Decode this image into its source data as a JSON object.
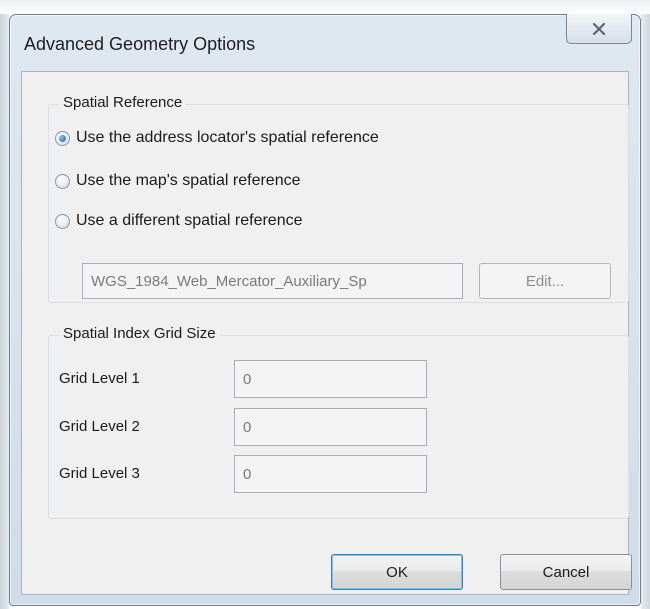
{
  "window": {
    "title": "Advanced Geometry Options",
    "close_icon": "close-x-icon"
  },
  "spatial_reference": {
    "legend": "Spatial Reference",
    "options": [
      {
        "label": "Use the address locator's spatial reference",
        "selected": true
      },
      {
        "label": "Use the map's spatial reference",
        "selected": false
      },
      {
        "label": "Use a different spatial reference",
        "selected": false
      }
    ],
    "reference_value": "WGS_1984_Web_Mercator_Auxiliary_Sp",
    "edit_label": "Edit..."
  },
  "grid_size": {
    "legend": "Spatial Index Grid Size",
    "levels": [
      {
        "label": "Grid Level 1",
        "value": "0"
      },
      {
        "label": "Grid Level 2",
        "value": "0"
      },
      {
        "label": "Grid Level 3",
        "value": "0"
      }
    ]
  },
  "buttons": {
    "ok_label": "OK",
    "cancel_label": "Cancel"
  }
}
